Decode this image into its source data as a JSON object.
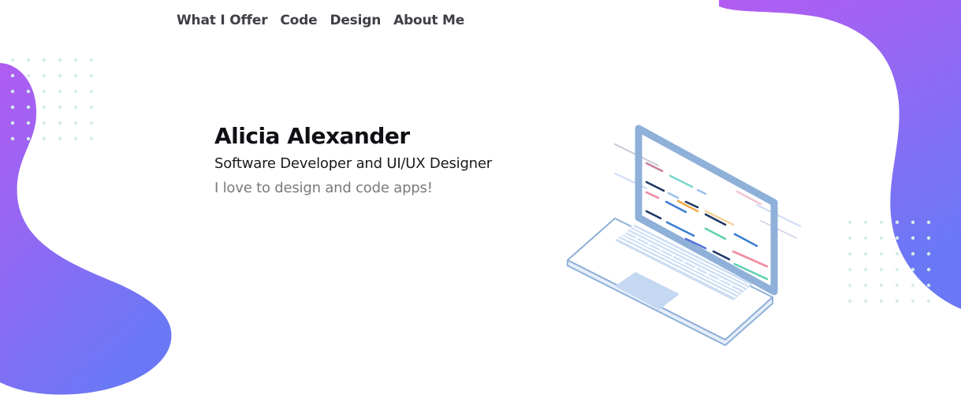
{
  "nav": {
    "items": [
      {
        "label": "What I Offer"
      },
      {
        "label": "Code"
      },
      {
        "label": "Design"
      },
      {
        "label": "About Me"
      }
    ]
  },
  "hero": {
    "name": "Alicia Alexander",
    "role": "Software Developer and UI/UX Designer",
    "tagline": "I love to design and code apps!"
  },
  "colors": {
    "gradient_start": "#b15cf2",
    "gradient_end": "#6a78f5",
    "dot_color": "#d7ece8",
    "laptop_outline": "#8fb0d8"
  },
  "icons": [
    "laptop-illustration",
    "dot-grid-left",
    "dot-grid-right"
  ]
}
